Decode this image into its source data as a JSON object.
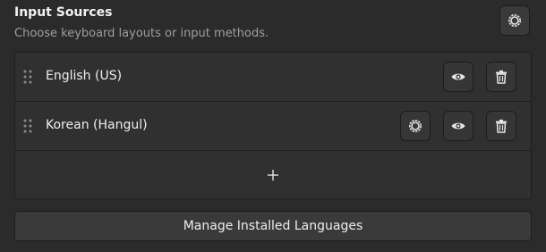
{
  "section": {
    "title": "Input Sources",
    "subtitle": "Choose keyboard layouts or input methods.",
    "settings_icon": "gear-icon"
  },
  "input_sources": [
    {
      "label": "English (US)",
      "has_settings": false,
      "icons": [
        "drag-handle-icon",
        "eye-icon",
        "trash-icon"
      ]
    },
    {
      "label": "Korean (Hangul)",
      "has_settings": true,
      "icons": [
        "drag-handle-icon",
        "gear-icon",
        "eye-icon",
        "trash-icon"
      ]
    }
  ],
  "add_row": {
    "icon": "plus-icon"
  },
  "manage_button": {
    "label": "Manage Installed Languages"
  },
  "colors": {
    "background": "#2b2b2b",
    "list_background": "#303030",
    "button_background": "#3a3a3a",
    "text": "#eeeeee",
    "subtitle_text": "#9e9e9e"
  }
}
